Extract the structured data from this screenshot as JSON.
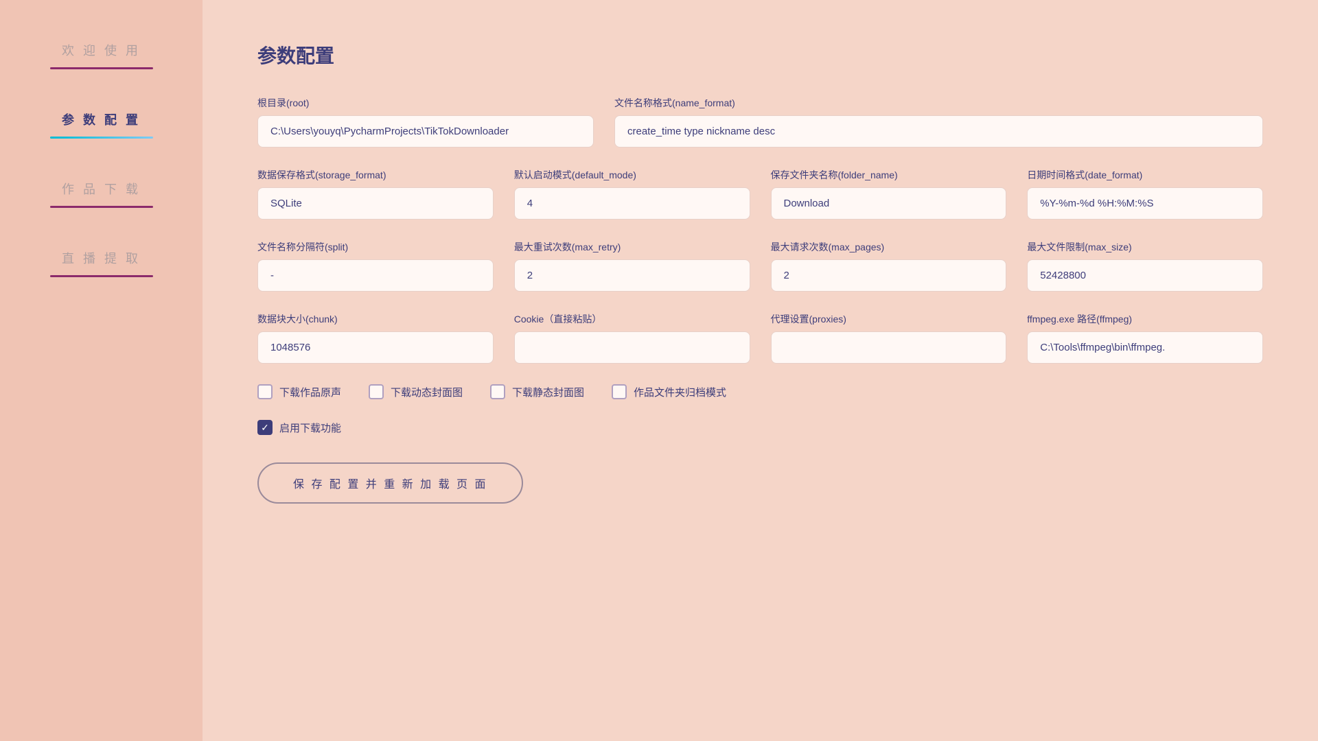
{
  "sidebar": {
    "items": [
      {
        "id": "welcome",
        "label": "欢 迎 使 用",
        "active": false,
        "underline_class": "sidebar-underline"
      },
      {
        "id": "params",
        "label": "参 数 配 置",
        "active": true,
        "underline_class": "sidebar-underline cyan"
      },
      {
        "id": "works",
        "label": "作 品 下 载",
        "active": false,
        "underline_class": "sidebar-underline"
      },
      {
        "id": "live",
        "label": "直 播 提 取",
        "active": false,
        "underline_class": "sidebar-underline"
      }
    ]
  },
  "page": {
    "title": "参数配置",
    "fields": {
      "root_label": "根目录(root)",
      "root_value": "C:\\Users\\youyq\\PycharmProjects\\TikTokDownloader",
      "name_format_label": "文件名称格式(name_format)",
      "name_format_value": "create_time type nickname desc",
      "storage_format_label": "数据保存格式(storage_format)",
      "storage_format_value": "SQLite",
      "default_mode_label": "默认启动模式(default_mode)",
      "default_mode_value": "4",
      "folder_name_label": "保存文件夹名称(folder_name)",
      "folder_name_value": "Download",
      "date_format_label": "日期时间格式(date_format)",
      "date_format_value": "%Y-%m-%d %H:%M:%S",
      "split_label": "文件名称分隔符(split)",
      "split_value": "-",
      "max_retry_label": "最大重试次数(max_retry)",
      "max_retry_value": "2",
      "max_pages_label": "最大请求次数(max_pages)",
      "max_pages_value": "2",
      "max_size_label": "最大文件限制(max_size)",
      "max_size_value": "52428800",
      "chunk_label": "数据块大小(chunk)",
      "chunk_value": "1048576",
      "cookie_label": "Cookie（直接粘贴）",
      "cookie_value": "",
      "proxies_label": "代理设置(proxies)",
      "proxies_value": "",
      "ffmpeg_label": "ffmpeg.exe 路径(ffmpeg)",
      "ffmpeg_value": "C:\\Tools\\ffmpeg\\bin\\ffmpeg.",
      "cb_original_label": "下载作品原声",
      "cb_original_checked": false,
      "cb_dynamic_label": "下载动态封面图",
      "cb_dynamic_checked": false,
      "cb_static_label": "下载静态封面图",
      "cb_static_checked": false,
      "cb_archive_label": "作品文件夹归档模式",
      "cb_archive_checked": false,
      "cb_enable_label": "启用下载功能",
      "cb_enable_checked": true,
      "save_button_label": "保 存 配 置 并 重 新 加 载 页 面"
    }
  }
}
